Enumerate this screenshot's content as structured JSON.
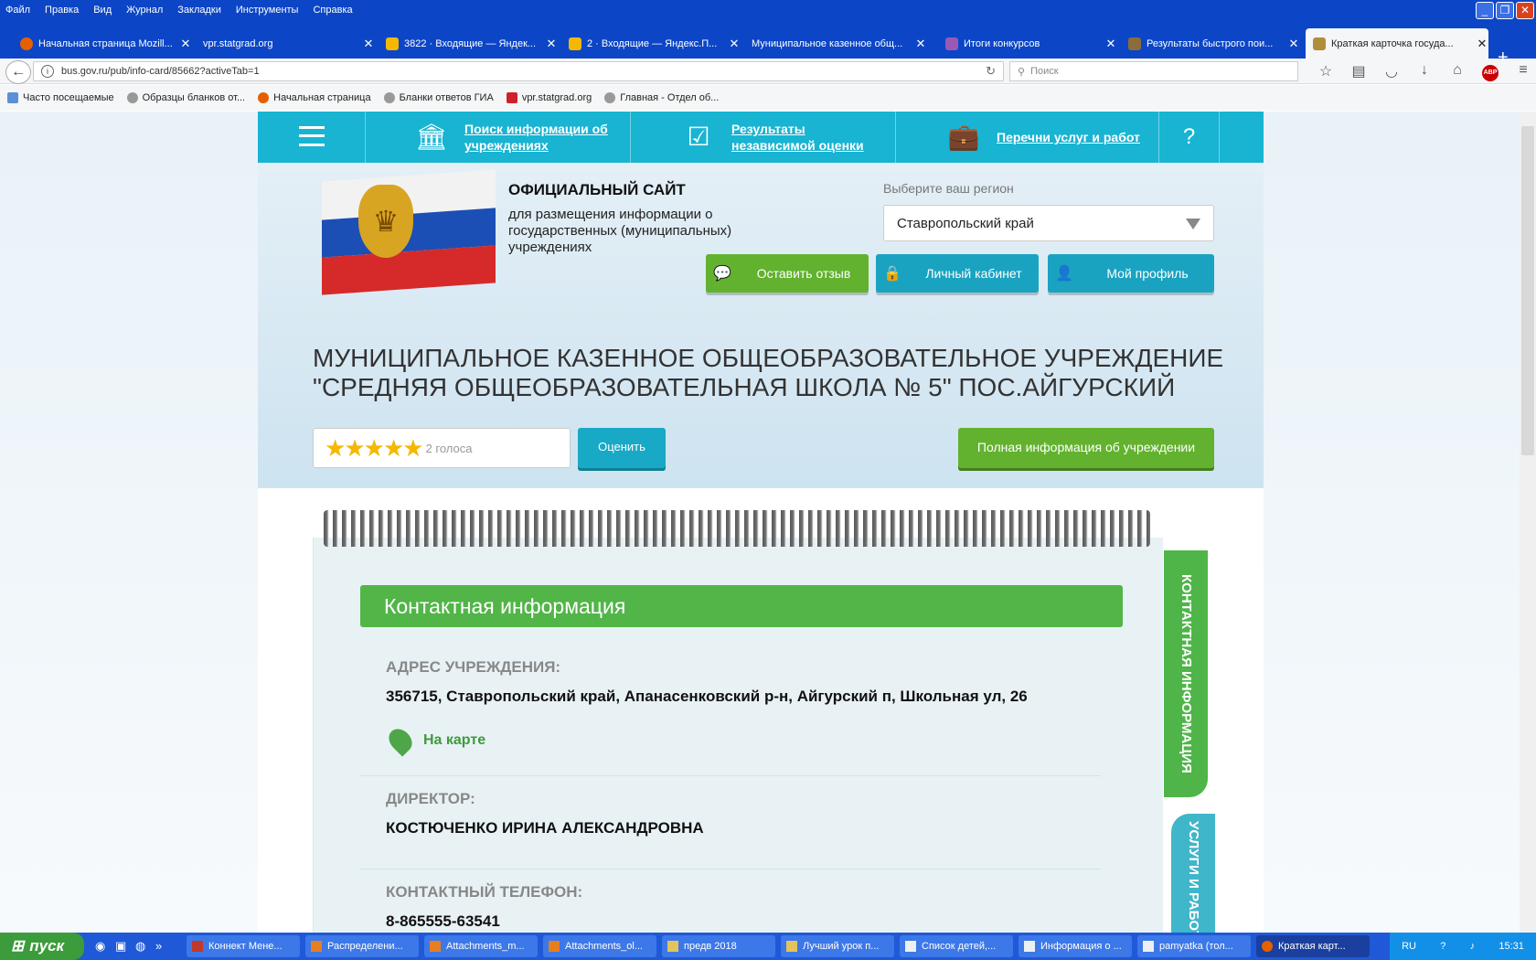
{
  "menubar": {
    "items": [
      "Файл",
      "Правка",
      "Вид",
      "Журнал",
      "Закладки",
      "Инструменты",
      "Справка"
    ]
  },
  "tabs": [
    {
      "label": "Начальная страница Mozill...",
      "color": "#e66000"
    },
    {
      "label": "vpr.statgrad.org",
      "color": "#1f5fe0"
    },
    {
      "label": "3822 · Входящие — Яндек...",
      "color": "#f5b800"
    },
    {
      "label": "2 · Входящие — Яндекс.П...",
      "color": "#f5b800"
    },
    {
      "label": "Муниципальное казенное общ...",
      "color": "#1f5fe0"
    },
    {
      "label": "Итоги конкурсов",
      "color": "#9b59b6"
    },
    {
      "label": "Результаты быстрого пои...",
      "color": "#8a6d3b"
    },
    {
      "label": "Краткая карточка госуда...",
      "color": "#b08d3b"
    }
  ],
  "newtab": "+",
  "nav": {
    "url": "bus.gov.ru/pub/info-card/85662?activeTab=1",
    "search_placeholder": "Поиск"
  },
  "bookmarks": [
    "Часто посещаемые",
    "Образцы бланков от...",
    "Начальная страница",
    "Бланки ответов ГИА",
    "vpr.statgrad.org",
    "Главная - Отдел об..."
  ],
  "site": {
    "nav": [
      "Поиск информации об учреждениях",
      "Результаты независимой оценки",
      "Перечни услуг и работ"
    ],
    "official_title": "ОФИЦИАЛЬНЫЙ САЙТ",
    "official_sub": "для размещения информации о государственных (муниципальных) учреждениях",
    "region_label": "Выберите ваш регион",
    "region_value": "Ставропольский край",
    "btn_feedback": "Оставить отзыв",
    "btn_cabinet": "Личный кабинет",
    "btn_profile": "Мой профиль",
    "org_title": "МУНИЦИПАЛЬНОЕ КАЗЕННОЕ ОБЩЕОБРАЗОВАТЕЛЬНОЕ УЧРЕЖДЕНИЕ \"СРЕДНЯЯ ОБЩЕОБРАЗОВАТЕЛЬНАЯ ШКОЛА № 5\" ПОС.АЙГУРСКИЙ",
    "rating_stars": 5,
    "votes": "2 голоса",
    "rate_btn": "Оценить",
    "full_info_btn": "Полная информация об учреждении"
  },
  "contact": {
    "heading": "Контактная информация",
    "address_label": "АДРЕС УЧРЕЖДЕНИЯ:",
    "address": "356715, Ставропольский край, Апанасенковский р-н, Айгурский п, Школьная ул, 26",
    "map_link": "На карте",
    "director_label": "ДИРЕКТОР:",
    "director": "КОСТЮЧЕНКО ИРИНА АЛЕКСАНДРОВНА",
    "phone_label": "КОНТАКТНЫЙ ТЕЛЕФОН:",
    "phone": "8-865555-63541",
    "side_tab_1": "КОНТАКТНАЯ ИНФОРМАЦИЯ",
    "side_tab_2": "УСЛУГИ И РАБОТЫ"
  },
  "taskbar": {
    "start": "пуск",
    "tasks": [
      "Коннект Мене...",
      "Распределени...",
      "Attachments_m...",
      "Attachments_ol...",
      "предв 2018",
      "Лучший урок п...",
      "Список детей,...",
      "Информация о ...",
      "pamyatka (тол...",
      "Краткая карт..."
    ],
    "lang": "RU",
    "time": "15:31"
  }
}
